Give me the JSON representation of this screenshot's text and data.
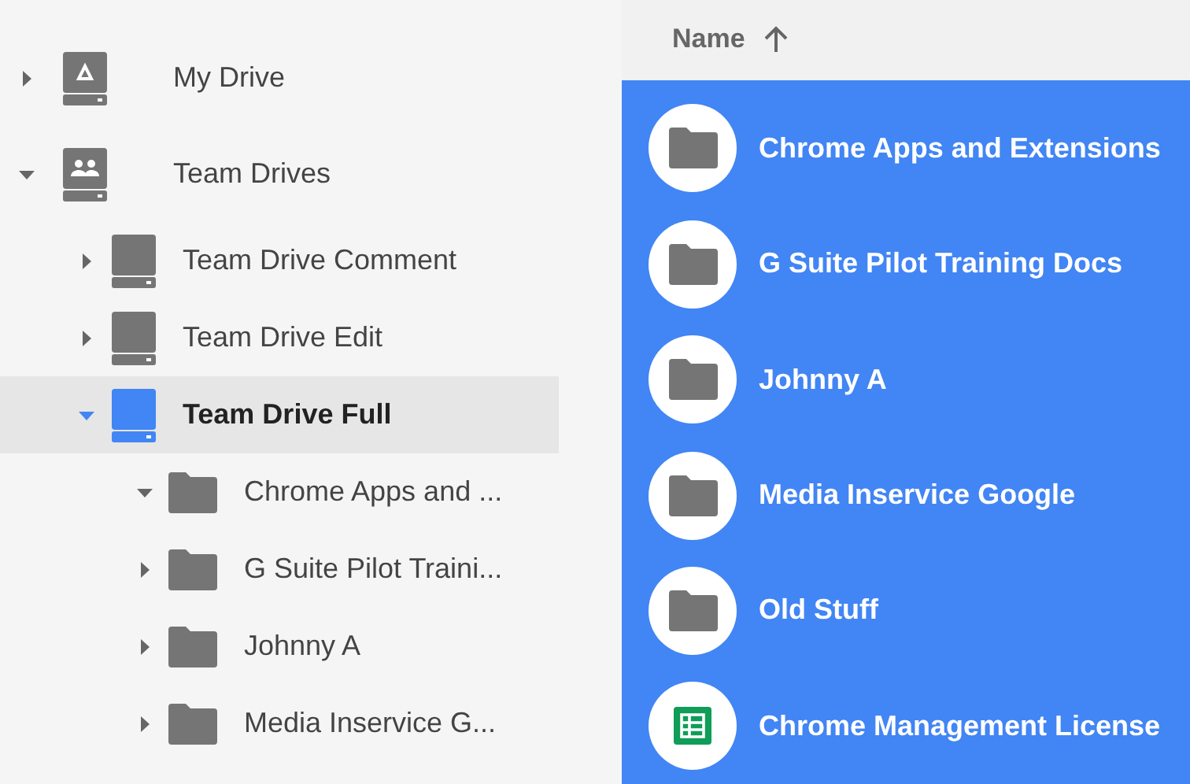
{
  "tree": [
    {
      "label": "My Drive",
      "kind": "my-drive",
      "expanded": false,
      "selected": false
    },
    {
      "label": "Team Drives",
      "kind": "team-drives",
      "expanded": true,
      "selected": false,
      "children": [
        {
          "label": "Team Drive Comment",
          "kind": "team-drive",
          "expanded": false,
          "selected": false
        },
        {
          "label": "Team Drive Edit",
          "kind": "team-drive",
          "expanded": false,
          "selected": false
        },
        {
          "label": "Team Drive Full",
          "kind": "team-drive",
          "expanded": true,
          "selected": true,
          "children": [
            {
              "label": "Chrome Apps and ...",
              "kind": "folder",
              "expanded": true,
              "selected": false
            },
            {
              "label": "G Suite Pilot Traini...",
              "kind": "folder",
              "expanded": false,
              "selected": false
            },
            {
              "label": "Johnny A",
              "kind": "folder",
              "expanded": false,
              "selected": false
            },
            {
              "label": "Media Inservice G...",
              "kind": "folder",
              "expanded": false,
              "selected": false
            }
          ]
        }
      ]
    }
  ],
  "list": {
    "header": {
      "label": "Name",
      "sorted_ascending": true
    },
    "rows": [
      {
        "name": "Chrome Apps and Extensions",
        "kind": "folder",
        "selected": true
      },
      {
        "name": "G Suite Pilot Training Docs",
        "kind": "folder",
        "selected": true
      },
      {
        "name": "Johnny A",
        "kind": "folder",
        "selected": true
      },
      {
        "name": "Media Inservice Google",
        "kind": "folder",
        "selected": true
      },
      {
        "name": "Old Stuff",
        "kind": "folder",
        "selected": true
      },
      {
        "name": "Chrome Management License",
        "kind": "sheet",
        "selected": true
      }
    ]
  }
}
